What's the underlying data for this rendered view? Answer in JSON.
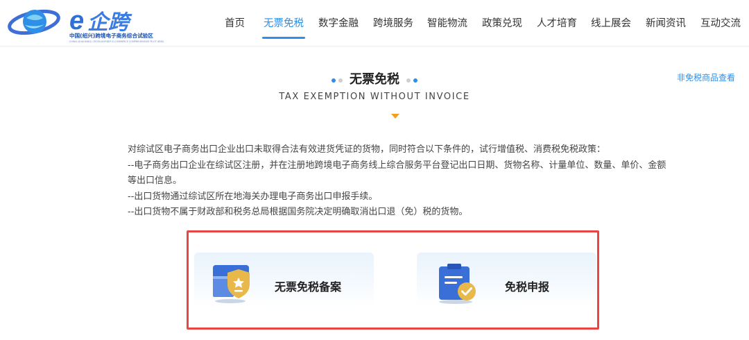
{
  "logo": {
    "brand": "e企跨",
    "subtitle": "中国(绍兴)跨境电子商务综合试验区",
    "subtitle_en": "CHINA (SHAOXING) CROSS-BORDER E-COMMERCE COMPREHENSIVE PILOT AREA"
  },
  "nav": {
    "items": [
      {
        "label": "首页"
      },
      {
        "label": "无票免税"
      },
      {
        "label": "数字金融"
      },
      {
        "label": "跨境服务"
      },
      {
        "label": "智能物流"
      },
      {
        "label": "政策兑现"
      },
      {
        "label": "人才培育"
      },
      {
        "label": "线上展会"
      },
      {
        "label": "新闻资讯"
      },
      {
        "label": "互动交流"
      }
    ],
    "active": "无票免税"
  },
  "section": {
    "title": "无票免税",
    "subtitle": "TAX EXEMPTION WITHOUT INVOICE",
    "side_link": "非免税商品查看"
  },
  "description": [
    "对综试区电子商务出口企业出口未取得合法有效进货凭证的货物，同时符合以下条件的，试行增值税、消费税免税政策：",
    "--电子商务出口企业在综试区注册，并在注册地跨境电子商务线上综合服务平台登记出口日期、货物名称、计量单位、数量、单价、金额等出口信息。",
    "--出口货物通过综试区所在地海关办理电子商务出口申报手续。",
    "--出口货物不属于财政部和税务总局根据国务院决定明确取消出口退（免）税的货物。"
  ],
  "cards": [
    {
      "label": "无票免税备案",
      "icon": "shield-icon"
    },
    {
      "label": "免税申报",
      "icon": "clipboard-check-icon"
    }
  ],
  "colors": {
    "accent": "#2f8ee6",
    "highlight_border": "#e84545",
    "arrow": "#f0a020",
    "icon_gold": "#e8b94a",
    "icon_blue": "#3a6fd8"
  }
}
